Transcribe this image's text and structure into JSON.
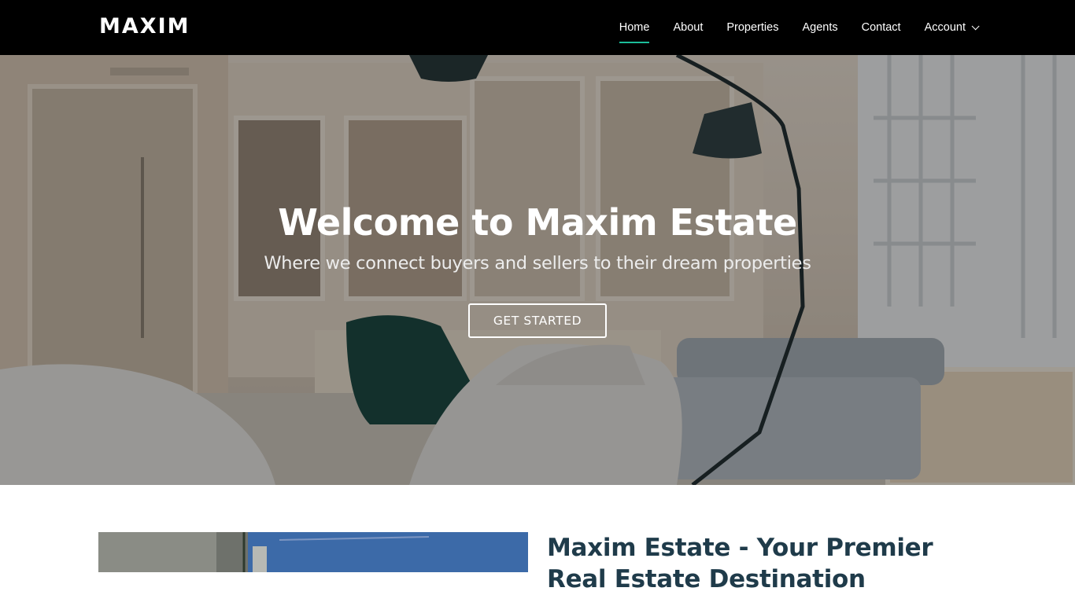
{
  "brand": {
    "name": "MAXIM"
  },
  "nav": {
    "items": [
      {
        "label": "Home",
        "active": true
      },
      {
        "label": "About",
        "active": false
      },
      {
        "label": "Properties",
        "active": false
      },
      {
        "label": "Agents",
        "active": false
      },
      {
        "label": "Contact",
        "active": false
      },
      {
        "label": "Account",
        "active": false,
        "dropdown": true
      }
    ]
  },
  "hero": {
    "title": "Welcome to Maxim Estate",
    "subtitle": "Where we connect buyers and sellers to their dream properties",
    "cta_label": "GET STARTED"
  },
  "about": {
    "title": "Maxim Estate - Your Premier Real Estate Destination"
  },
  "colors": {
    "navbar_bg": "#000000",
    "accent": "#1bbd9a",
    "heading": "#1f3b4a"
  }
}
